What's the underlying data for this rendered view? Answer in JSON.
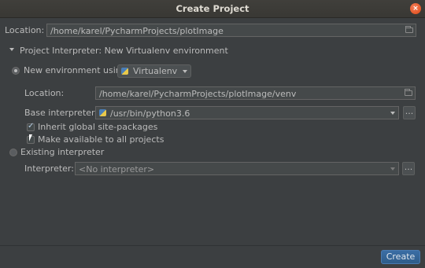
{
  "window": {
    "title": "Create Project"
  },
  "project_location": {
    "label": "Location:",
    "value": "/home/karel/PycharmProjects/plotImage"
  },
  "interpreter_section": {
    "label": "Project Interpreter: New Virtualenv environment"
  },
  "new_env": {
    "label": "New environment using",
    "tool": "Virtualenv",
    "location_label": "Location:",
    "location_value": "/home/karel/PycharmProjects/plotImage/venv",
    "base_label": "Base interpreter:",
    "base_value": "/usr/bin/python3.6",
    "inherit_label": "Inherit global site-packages",
    "make_available_label": "Make available to all projects"
  },
  "existing": {
    "label": "Existing interpreter",
    "interpreter_label": "Interpreter:",
    "interpreter_value": "<No interpreter>"
  },
  "buttons": {
    "browse": "...",
    "create": "Create"
  },
  "colors": {
    "background": "#3c3f41",
    "accent": "#2e5c8a",
    "close": "#dd4814"
  }
}
